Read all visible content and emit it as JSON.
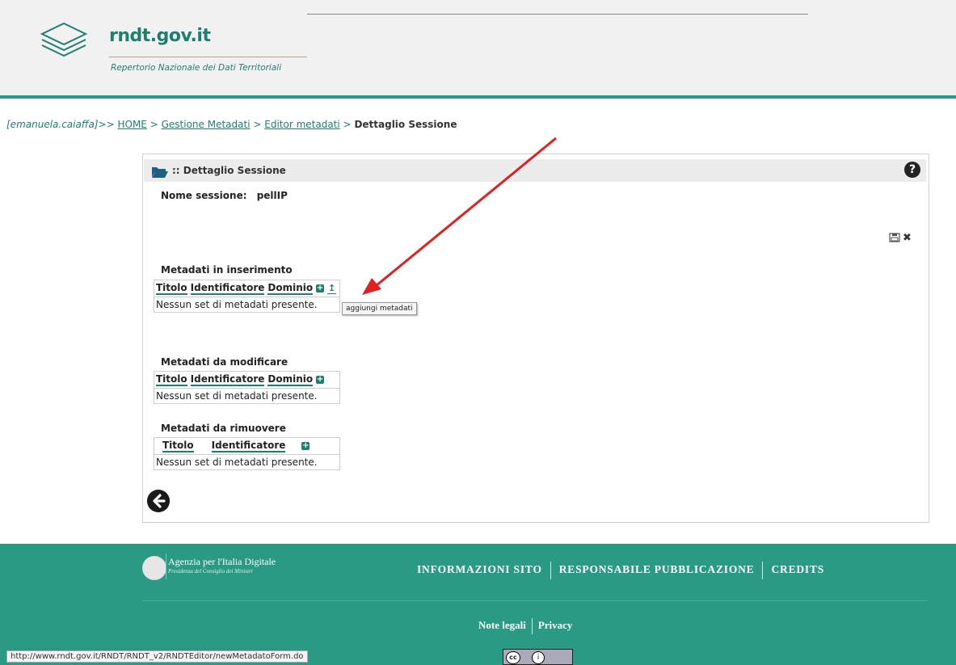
{
  "header": {
    "site_title": "rndt.gov.it",
    "site_subtitle": "Repertorio Nazionale dei Dati Territoriali"
  },
  "breadcrumb": {
    "user": "[emanuela.caiaffa]",
    "prefix": ">>",
    "items": [
      "HOME",
      "Gestione Metadati",
      "Editor metadati"
    ],
    "current": "Dettaglio Sessione",
    "separator": ">"
  },
  "panel": {
    "title": ":: Dettaglio Sessione",
    "session_label": "Nome sessione:",
    "session_name": "pellIP",
    "sections": [
      {
        "title": "Metadati in inserimento",
        "columns": [
          "Titolo",
          "Identificatore",
          "Dominio"
        ],
        "empty_text": "Nessun set di metadati presente."
      },
      {
        "title": "Metadati da modificare",
        "columns": [
          "Titolo",
          "Identificatore",
          "Dominio"
        ],
        "empty_text": "Nessun set di metadati presente."
      },
      {
        "title": "Metadati da rimuovere",
        "columns": [
          "Titolo",
          "Identificatore"
        ],
        "empty_text": "Nessun set di metadati presente."
      }
    ],
    "tooltip": "aggiungi metadati"
  },
  "footer": {
    "agency_name": "Agenzia per l'Italia Digitale",
    "agency_sub": "Presidenza del Consiglio dei Ministri",
    "nav": [
      "INFORMAZIONI SITO",
      "RESPONSABILE PUBBLICAZIONE",
      "CREDITS"
    ],
    "links": [
      "Note legali",
      "Privacy"
    ],
    "status_url": "http://www.rndt.gov.it/RNDT/RNDT_v2/RNDTEditor/newMetadatoForm.do"
  },
  "colors": {
    "accent": "#2a9a84",
    "annotation_arrow": "#e02020"
  }
}
